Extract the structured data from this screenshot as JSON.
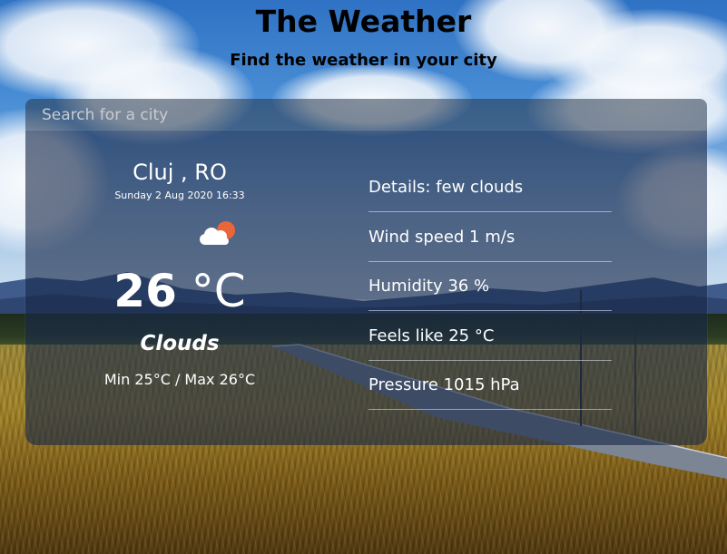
{
  "header": {
    "title": "The Weather",
    "subtitle": "Find the weather in your city"
  },
  "search": {
    "placeholder": "Search for a city",
    "value": ""
  },
  "current": {
    "location": "Cluj , RO",
    "datetime": "Sunday 2 Aug 2020 16:33",
    "icon": "few-clouds-day-icon",
    "temperature_value": "26",
    "temperature_unit": "°C",
    "condition": "Clouds",
    "min_max": "Min 25°C / Max 26°C"
  },
  "details": [
    {
      "label": "Details: few clouds"
    },
    {
      "label": "Wind speed 1 m/s"
    },
    {
      "label": "Humidity 36 %"
    },
    {
      "label": "Feels like 25 °C"
    },
    {
      "label": "Pressure 1015 hPa"
    }
  ],
  "colors": {
    "card_bg": "#18284a",
    "text_light": "#ffffff",
    "header_text": "#000000",
    "sun": "#e8663a"
  }
}
